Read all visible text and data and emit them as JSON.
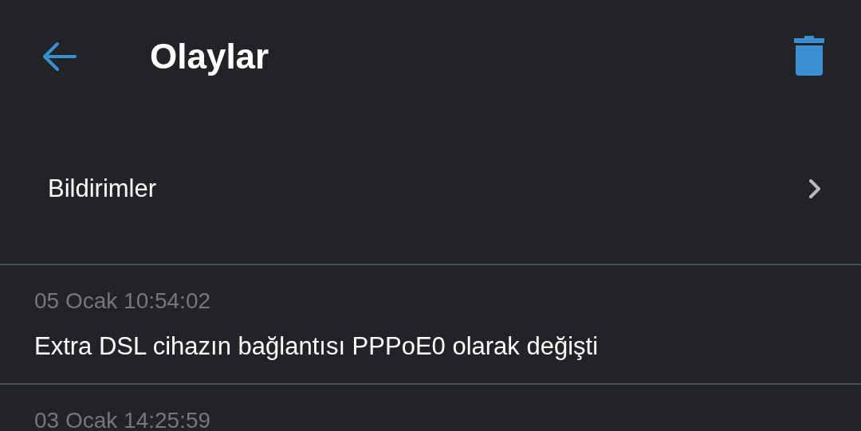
{
  "header": {
    "title": "Olaylar"
  },
  "notifications_row": {
    "label": "Bildirimler"
  },
  "events": [
    {
      "time": "05 Ocak 10:54:02",
      "message": "Extra DSL cihazın bağlantısı PPPoE0 olarak değişti"
    },
    {
      "time": "03 Ocak 14:25:59"
    }
  ]
}
